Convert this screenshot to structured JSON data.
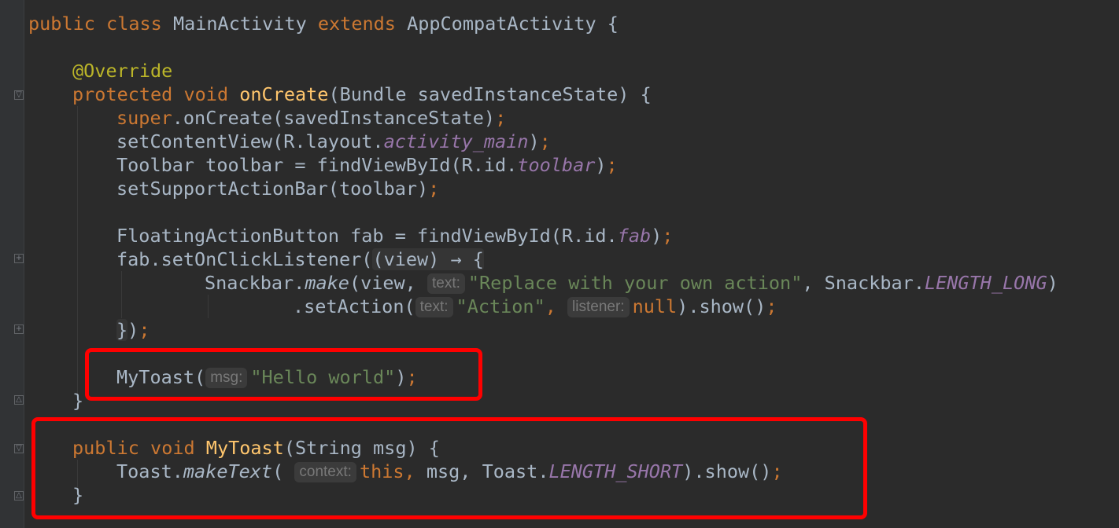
{
  "code": {
    "line1": {
      "kw_public": "public",
      "kw_class": "class",
      "class_name": "MainActivity",
      "kw_extends": "extends",
      "super_class": "AppCompatActivity",
      "brace": "{"
    },
    "line2": {
      "annotation": "@Override"
    },
    "line3": {
      "kw_protected": "protected",
      "kw_void": "void",
      "method": "onCreate",
      "params": "(Bundle savedInstanceState) {"
    },
    "line4": {
      "kw_super": "super",
      "rest": ".onCreate(savedInstanceState)",
      "semi": ";"
    },
    "line5": {
      "prefix": "setContentView(R.layout.",
      "field": "activity_main",
      "suffix": ")",
      "semi": ";"
    },
    "line6": {
      "prefix": "Toolbar toolbar = findViewById(R.id.",
      "field": "toolbar",
      "suffix": ")",
      "semi": ";"
    },
    "line7": {
      "text": "setSupportActionBar(toolbar)",
      "semi": ";"
    },
    "line8": {
      "prefix": "FloatingActionButton fab = findViewById(R.id.",
      "field": "fab",
      "suffix": ")",
      "semi": ";"
    },
    "line9": {
      "prefix": "fab.setOnClickListener(",
      "lambda": "(view) → {"
    },
    "line10": {
      "prefix": "Snackbar.",
      "method": "make",
      "open": "(view,",
      "hint": "text:",
      "string": "\"Replace with your own action\"",
      "mid": ", Snackbar.",
      "field": "LENGTH_LONG",
      "close": ")"
    },
    "line11": {
      "prefix": ".setAction(",
      "hint1": "text:",
      "string": "\"Action\"",
      "comma": ",",
      "hint2": "listener:",
      "kw_null": "null",
      "suffix": ").show()",
      "semi": ";"
    },
    "line12": {
      "close_brace": "}",
      "paren": ")",
      "semi": ";"
    },
    "line13": {
      "prefix": "MyToast(",
      "hint": "msg:",
      "string": "\"Hello world\"",
      "suffix": ")",
      "semi": ";"
    },
    "line14": {
      "brace": "}"
    },
    "line15": {
      "kw_public": "public",
      "kw_void": "void",
      "method": "MyToast",
      "params": "(String msg) {"
    },
    "line16": {
      "prefix": "Toast.",
      "method": "makeText",
      "open": "(",
      "hint": "context:",
      "kw_this": "this",
      "comma": ",",
      "mid": " msg, Toast.",
      "field": "LENGTH_SHORT",
      "suffix": ").show()",
      "semi": ";"
    },
    "line17": {
      "brace": "}"
    }
  },
  "colors": {
    "highlight_border": "#ff0000",
    "background": "#2b2b2b",
    "keyword": "#cc7832",
    "string": "#6a8759",
    "field": "#9876aa",
    "method_decl": "#ffc66d"
  },
  "icons": [
    "fold-collapse-icon",
    "fold-expand-icon"
  ]
}
